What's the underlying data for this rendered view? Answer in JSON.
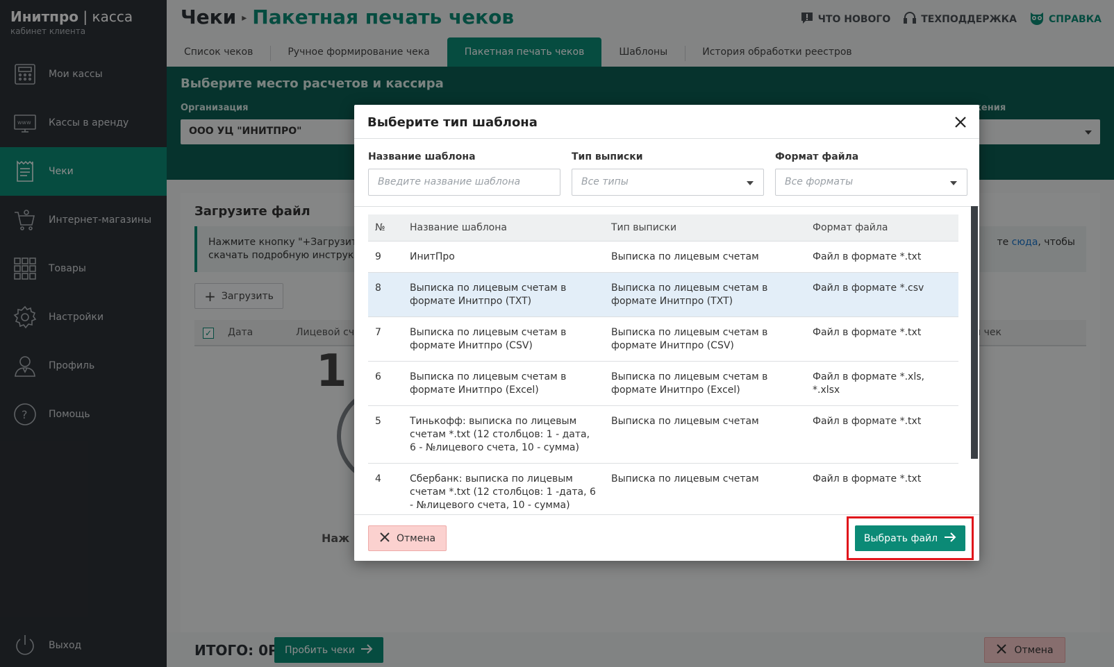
{
  "sidebar": {
    "brand_main": "Инитпро",
    "brand_pipe": " | ",
    "brand_thin": "касса",
    "brand_sub": "кабинет клиента",
    "items": [
      {
        "label": "Мои кассы",
        "icon": "cash-register-icon"
      },
      {
        "label": "Кассы в аренду",
        "icon": "www-monitor-icon"
      },
      {
        "label": "Чеки",
        "icon": "receipt-icon"
      },
      {
        "label": "Интернет-магазины",
        "icon": "shopping-cart-icon"
      },
      {
        "label": "Товары",
        "icon": "grid-icon"
      },
      {
        "label": "Настройки",
        "icon": "gear-icon"
      },
      {
        "label": "Профиль",
        "icon": "user-icon"
      },
      {
        "label": "Помощь",
        "icon": "help-icon"
      }
    ],
    "logout": "Выход"
  },
  "header": {
    "crumb_parent": "Чеки",
    "crumb_current": "Пакетная печать чеков",
    "links": {
      "news": "ЧТО НОВОГО",
      "support": "ТЕХПОДДЕРЖКА",
      "help": "СПРАВКА"
    }
  },
  "tabs": [
    {
      "label": "Список чеков"
    },
    {
      "label": "Ручное формирование чека"
    },
    {
      "label": "Пакетная печать чеков"
    },
    {
      "label": "Шаблоны"
    },
    {
      "label": "История обработки реестров"
    }
  ],
  "band": {
    "title": "Выберите место расчетов и кассира",
    "org_label": "Организация",
    "org_value": "ООО УЦ \"ИНИТПРО\"",
    "right_label": "жения"
  },
  "main": {
    "title": "Загрузите файл",
    "info_line1": "Нажмите кнопку \"+Загрузить\",",
    "info_line2": "скачать подробную инструкци",
    "info_right_prefix": "те ",
    "info_right_link": "сюда",
    "info_right_suffix": ", чтобы",
    "upload_label": "Загрузить",
    "col_date": "Дата",
    "col_account": "Лицевой сч",
    "col_right": "ый чек",
    "big_num": "1",
    "press_text": "Наж"
  },
  "footer": {
    "total": "ИТОГО: 0Р",
    "probit_label": "Пробить чеки",
    "cancel_label": "Отмена"
  },
  "modal": {
    "title": "Выберите тип шаблона",
    "filters": {
      "name_label": "Название шаблона",
      "name_placeholder": "Введите название шаблона",
      "type_label": "Тип выписки",
      "type_value": "Все типы",
      "format_label": "Формат файла",
      "format_value": "Все форматы"
    },
    "columns": {
      "num": "№",
      "name": "Название шаблона",
      "type": "Тип выписки",
      "format": "Формат файла"
    },
    "rows": [
      {
        "num": "9",
        "name": "ИнитПро",
        "type": "Выписка по лицевым счетам",
        "format": "Файл в формате *.txt",
        "selected": false
      },
      {
        "num": "8",
        "name": "Выписка по лицевым счетам в формате Инитпро (TXT)",
        "type": "Выписка по лицевым счетам в формате Инитпро (TXT)",
        "format": "Файл в формате *.csv",
        "selected": true
      },
      {
        "num": "7",
        "name": "Выписка по лицевым счетам в формате Инитпро (CSV)",
        "type": "Выписка по лицевым счетам в формате Инитпро (CSV)",
        "format": "Файл в формате *.txt",
        "selected": false
      },
      {
        "num": "6",
        "name": "Выписка по лицевым счетам в формате Инитпро (Excel)",
        "type": "Выписка по лицевым счетам в формате Инитпро (Excel)",
        "format": "Файл в формате *.xls, *.xlsx",
        "selected": false
      },
      {
        "num": "5",
        "name": "Тинькофф: выписка по лицевым счетам *.txt (12 столбцов: 1 - дата, 6 - №лицевого счета, 10 - сумма)",
        "type": "Выписка по лицевым счетам",
        "format": "Файл в формате *.txt",
        "selected": false
      },
      {
        "num": "4",
        "name": "Сбербанк: выписка по лицевым счетам *.txt (12 столбцов: 1 -дата, 6 - №лицевого счета, 10 - сумма)",
        "type": "Выписка по лицевым счетам",
        "format": "Файл в формате *.txt",
        "selected": false
      }
    ],
    "cancel_label": "Отмена",
    "choose_label": "Выбрать файл"
  },
  "colors": {
    "accent": "#0b8a76",
    "band": "#0b5e53",
    "sidebar": "#2d3237",
    "highlight": "#e0151b",
    "selected_row": "#e3eef8"
  }
}
